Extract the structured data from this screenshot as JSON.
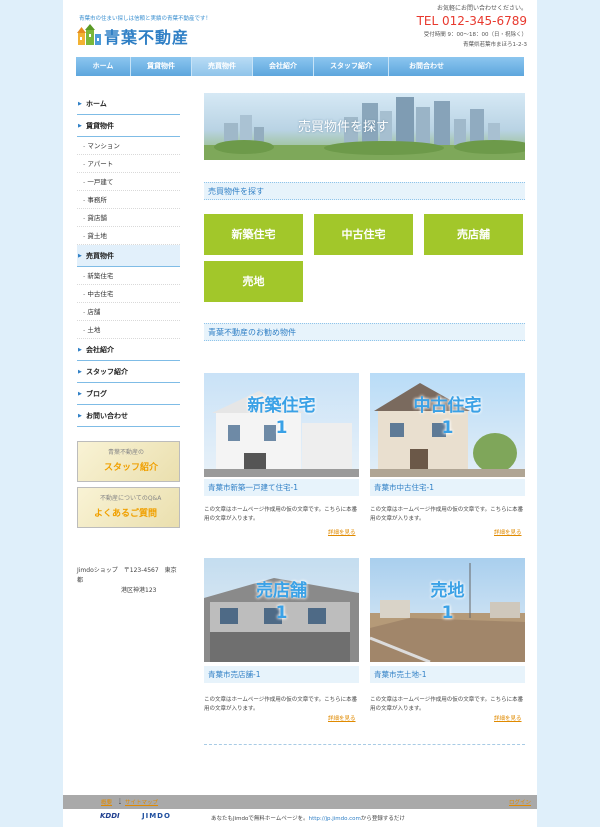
{
  "header": {
    "tagline": "青葉市の住まい探しは信頼と実績の青葉不動産です！",
    "logo": "青葉不動産",
    "contact": "お気軽にお問い合わせください。",
    "tel": "TEL 012-345-6789",
    "hours": "受付時間 9：00～18：00（日・祝除く）",
    "address": "青葉県若葉市まほろ1-2-3"
  },
  "nav": [
    {
      "label": "ホーム"
    },
    {
      "label": "賃貸物件"
    },
    {
      "label": "売買物件"
    },
    {
      "label": "会社紹介"
    },
    {
      "label": "スタッフ紹介"
    },
    {
      "label": "お問合わせ"
    }
  ],
  "sidebar": {
    "home": "ホーム",
    "rental": "賃貸物件",
    "rental_items": [
      "マンション",
      "アパート",
      "一戸建て",
      "事務所",
      "貸店舗",
      "貸土地"
    ],
    "sale": "売買物件",
    "sale_items": [
      "新築住宅",
      "中古住宅",
      "店舗",
      "土地"
    ],
    "company": "会社紹介",
    "staff": "スタッフ紹介",
    "blog": "ブログ",
    "contact": "お問い合わせ",
    "banner1_small": "青葉不動産の",
    "banner1_big": "スタッフ紹介",
    "banner2_small": "不動産についてのQ&A",
    "banner2_big": "よくあるご質問",
    "address_line1": "Jimdoショップ　〒123-4567　東京都",
    "address_line2": "港区神港123"
  },
  "main": {
    "hero_title": "売買物件を探す",
    "section1": "売買物件を探す",
    "categories": [
      "新築住宅",
      "中古住宅",
      "売店舗",
      "売地"
    ],
    "section2": "青葉不動産のお勧め物件",
    "properties": [
      {
        "overlay1": "新築住宅",
        "overlay2": "1",
        "title": "青葉市新築一戸建て住宅-1",
        "desc": "この文章はホームページ作成用の仮の文章です。こちらに本番用の文章が入ります。",
        "more": "詳細を見る"
      },
      {
        "overlay1": "中古住宅",
        "overlay2": "1",
        "title": "青葉市中古住宅-1",
        "desc": "この文章はホームページ作成用の仮の文章です。こちらに本番用の文章が入ります。",
        "more": "詳細を見る"
      },
      {
        "overlay1": "売店舗",
        "overlay2": "1",
        "title": "青葉市売店舗-1",
        "desc": "この文章はホームページ作成用の仮の文章です。こちらに本番用の文章が入ります。",
        "more": "詳細を見る"
      },
      {
        "overlay1": "売地",
        "overlay2": "1",
        "title": "青葉市売土地-1",
        "desc": "この文章はホームページ作成用の仮の文章です。こちらに本番用の文章が入ります。",
        "more": "詳細を見る"
      }
    ]
  },
  "footer": {
    "link1": "概要",
    "link2": "サイトマップ",
    "login": "ログイン"
  },
  "bottom": {
    "kddi": "KDDI",
    "jimdo": "JIMDO",
    "text1": "あなたもJimdoで無料ホームページを。",
    "link": "http://jp.jimdo.com",
    "text2": "から登録するだけ"
  },
  "colors": {
    "brand": "#2f7fc5",
    "accent": "#a2c72a",
    "tel": "#e8392e",
    "more": "#e08a00"
  }
}
